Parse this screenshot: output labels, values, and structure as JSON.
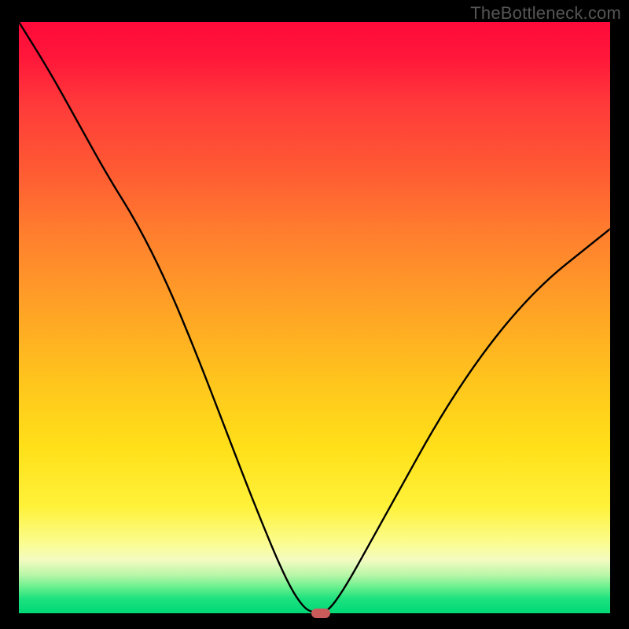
{
  "watermark": "TheBottleneck.com",
  "colors": {
    "background": "#000000",
    "curve": "#000000",
    "marker": "#c95a5a",
    "gradient_top": "#ff0a3a",
    "gradient_bottom": "#00d876"
  },
  "chart_data": {
    "type": "line",
    "title": "",
    "xlabel": "",
    "ylabel": "",
    "xlim": [
      0,
      100
    ],
    "ylim": [
      0,
      100
    ],
    "x": [
      0,
      5,
      10,
      15,
      20,
      25,
      30,
      35,
      40,
      45,
      48,
      50,
      52,
      55,
      60,
      65,
      70,
      75,
      80,
      85,
      90,
      95,
      100
    ],
    "values": [
      100,
      92,
      83,
      74,
      66,
      56,
      44,
      31,
      18,
      6,
      1,
      0,
      0,
      4,
      13,
      22,
      31,
      39,
      46,
      52,
      57,
      61,
      65
    ],
    "minimum": {
      "x": 51,
      "y": 0
    },
    "note": "V-shaped bottleneck curve over a red-to-green heat gradient. X axis is a normalized component-balance parameter (unlabeled in source). Y axis is bottleneck percentage (unlabeled). Minimum (optimal balance, ~0% bottleneck) sits around x≈51, marked by a small rounded red pill. Values are estimated from the plotted curve."
  }
}
